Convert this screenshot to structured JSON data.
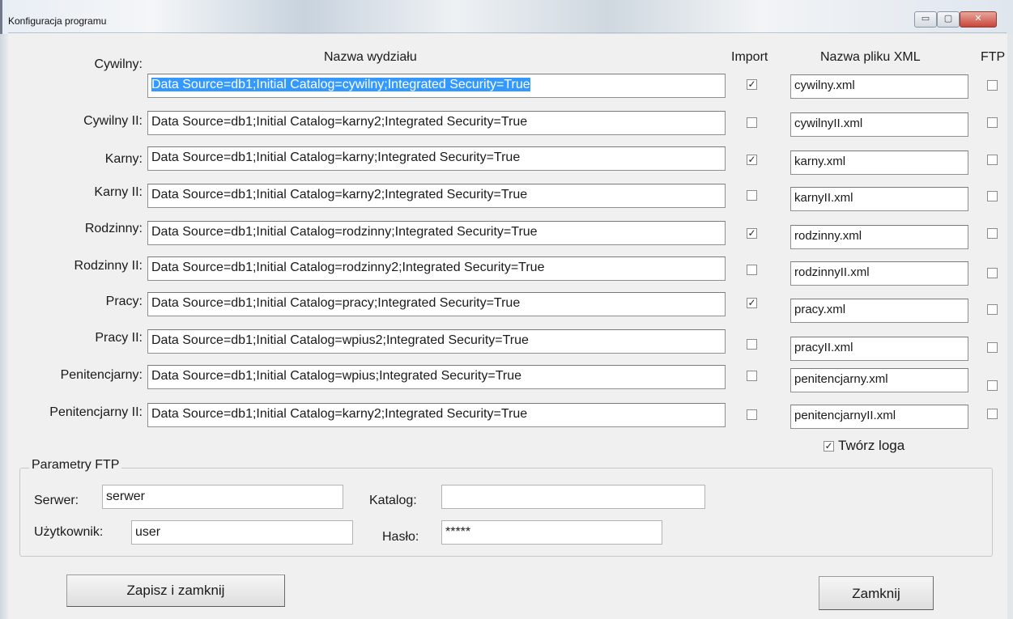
{
  "window": {
    "title": "Konfiguracja programu",
    "min_glyph": "▭",
    "max_glyph": "▢",
    "close_glyph": "✕"
  },
  "headers": {
    "name": "Nazwa wydziału",
    "import": "Import",
    "xml": "Nazwa pliku XML",
    "ftp": "FTP"
  },
  "rows": [
    {
      "label": "Cywilny:",
      "conn": "Data Source=db1;Initial Catalog=cywilny;Integrated Security=True",
      "import": true,
      "xml": "cywilny.xml",
      "ftp": false
    },
    {
      "label": "Cywilny II:",
      "conn": "Data Source=db1;Initial Catalog=karny2;Integrated Security=True",
      "import": false,
      "xml": "cywilnyII.xml",
      "ftp": false
    },
    {
      "label": "Karny:",
      "conn": "Data Source=db1;Initial Catalog=karny;Integrated Security=True",
      "import": true,
      "xml": "karny.xml",
      "ftp": false
    },
    {
      "label": "Karny II:",
      "conn": "Data Source=db1;Initial Catalog=karny2;Integrated Security=True",
      "import": false,
      "xml": "karnyII.xml",
      "ftp": false
    },
    {
      "label": "Rodzinny:",
      "conn": "Data Source=db1;Initial Catalog=rodzinny;Integrated Security=True",
      "import": true,
      "xml": "rodzinny.xml",
      "ftp": false
    },
    {
      "label": "Rodzinny II:",
      "conn": "Data Source=db1;Initial Catalog=rodzinny2;Integrated Security=True",
      "import": false,
      "xml": "rodzinnyII.xml",
      "ftp": false
    },
    {
      "label": "Pracy:",
      "conn": "Data Source=db1;Initial Catalog=pracy;Integrated Security=True",
      "import": true,
      "xml": "pracy.xml",
      "ftp": false
    },
    {
      "label": "Pracy II:",
      "conn": "Data Source=db1;Initial Catalog=wpius2;Integrated Security=True",
      "import": false,
      "xml": "pracyII.xml",
      "ftp": false
    },
    {
      "label": "Penitencjarny:",
      "conn": "Data Source=db1;Initial Catalog=wpius;Integrated Security=True",
      "import": false,
      "xml": "penitencjarny.xml",
      "ftp": false
    },
    {
      "label": "Penitencjarny II:",
      "conn": "Data Source=db1;Initial Catalog=karny2;Integrated Security=True",
      "import": false,
      "xml": "penitencjarnyII.xml",
      "ftp": false
    }
  ],
  "tworz_loga": {
    "label": "Twórz loga",
    "checked": true
  },
  "ftp": {
    "legend": "Parametry FTP",
    "server_label": "Serwer:",
    "server_value": "serwer",
    "catalog_label": "Katalog:",
    "catalog_value": "",
    "user_label": "Użytkownik:",
    "user_value": "user",
    "password_label": "Hasło:",
    "password_value": "*****"
  },
  "buttons": {
    "save": "Zapisz i zamknij",
    "close": "Zamknij"
  },
  "colors": {
    "selection": "#3399ff",
    "window_bg": "#f0f0f0"
  }
}
